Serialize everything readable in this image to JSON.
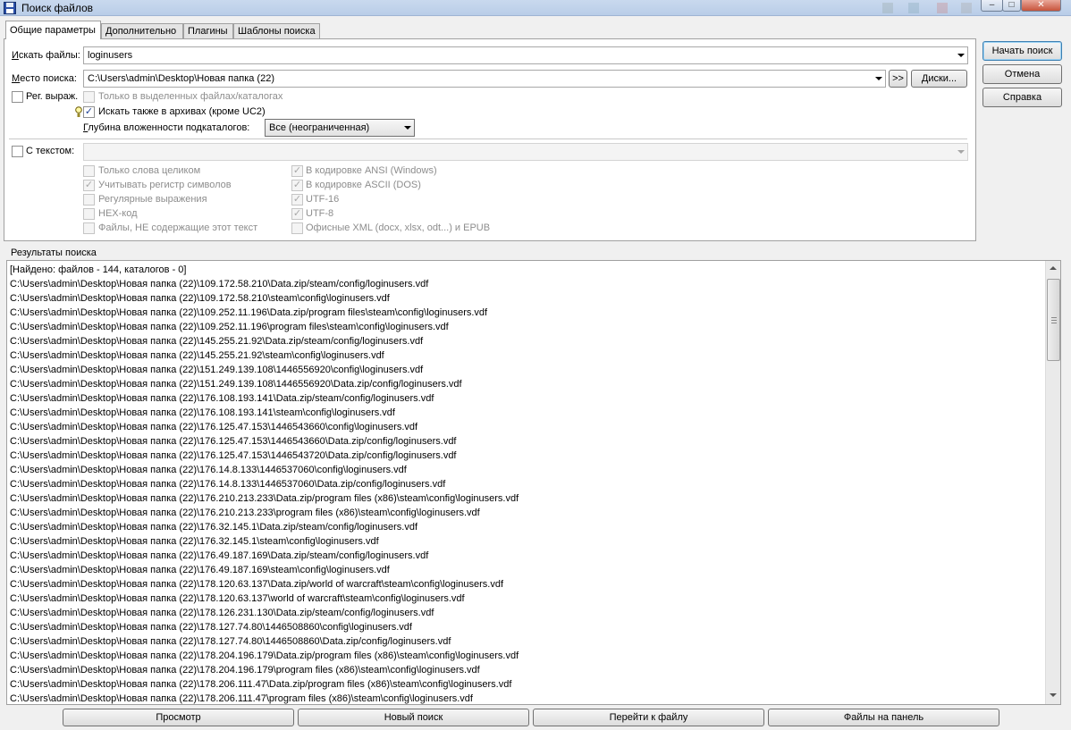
{
  "window": {
    "title": "Поиск файлов",
    "minimize": "–",
    "maximize": "□",
    "close": "✕"
  },
  "tabs": [
    {
      "label": "Общие параметры",
      "active": true
    },
    {
      "label": "Дополнительно",
      "active": false
    },
    {
      "label": "Плагины",
      "active": false
    },
    {
      "label": "Шаблоны поиска",
      "active": false
    }
  ],
  "general": {
    "search_files_label_u": "И",
    "search_files_label_rest": "скать файлы:",
    "search_files_value": "loginusers",
    "location_label_u": "М",
    "location_label_rest": "есто поиска:",
    "location_value": "C:\\Users\\admin\\Desktop\\Новая папка (22)",
    "browse_label": ">>",
    "drives_label": "Диски...",
    "regex_label": "Рег. выраж.",
    "only_selected_label": "Только в выделенных файлах/каталогах",
    "search_archives_label": "Искать также в архивах (кроме UC2)",
    "depth_label_u": "Г",
    "depth_label_rest": "лубина вложенности подкаталогов:",
    "depth_value": "Все (неограниченная)",
    "with_text_label": "С текстом:",
    "with_text_value": ""
  },
  "text_options": {
    "whole_words": "Только слова целиком",
    "case_sensitive": "Учитывать регистр символов",
    "regex": "Регулярные выражения",
    "hex": "HEX-код",
    "not_containing": "Файлы, НЕ содержащие этот текст",
    "ansi": "В кодировке ANSI (Windows)",
    "ascii": "В кодировке ASCII (DOS)",
    "utf16": "UTF-16",
    "utf8": "UTF-8",
    "office_xml": "Офисные XML (docx, xlsx, odt...) и EPUB"
  },
  "side_buttons": {
    "start": "Начать поиск",
    "cancel": "Отмена",
    "help": "Справка"
  },
  "results": {
    "label": "Результаты поиска",
    "items": [
      "[Найдено: файлов - 144, каталогов - 0]",
      "C:\\Users\\admin\\Desktop\\Новая папка (22)\\109.172.58.210\\Data.zip/steam/config/loginusers.vdf",
      "C:\\Users\\admin\\Desktop\\Новая папка (22)\\109.172.58.210\\steam\\config\\loginusers.vdf",
      "C:\\Users\\admin\\Desktop\\Новая папка (22)\\109.252.11.196\\Data.zip/program files\\steam\\config\\loginusers.vdf",
      "C:\\Users\\admin\\Desktop\\Новая папка (22)\\109.252.11.196\\program files\\steam\\config\\loginusers.vdf",
      "C:\\Users\\admin\\Desktop\\Новая папка (22)\\145.255.21.92\\Data.zip/steam/config/loginusers.vdf",
      "C:\\Users\\admin\\Desktop\\Новая папка (22)\\145.255.21.92\\steam\\config\\loginusers.vdf",
      "C:\\Users\\admin\\Desktop\\Новая папка (22)\\151.249.139.108\\1446556920\\config\\loginusers.vdf",
      "C:\\Users\\admin\\Desktop\\Новая папка (22)\\151.249.139.108\\1446556920\\Data.zip/config/loginusers.vdf",
      "C:\\Users\\admin\\Desktop\\Новая папка (22)\\176.108.193.141\\Data.zip/steam/config/loginusers.vdf",
      "C:\\Users\\admin\\Desktop\\Новая папка (22)\\176.108.193.141\\steam\\config\\loginusers.vdf",
      "C:\\Users\\admin\\Desktop\\Новая папка (22)\\176.125.47.153\\1446543660\\config\\loginusers.vdf",
      "C:\\Users\\admin\\Desktop\\Новая папка (22)\\176.125.47.153\\1446543660\\Data.zip/config/loginusers.vdf",
      "C:\\Users\\admin\\Desktop\\Новая папка (22)\\176.125.47.153\\1446543720\\Data.zip/config/loginusers.vdf",
      "C:\\Users\\admin\\Desktop\\Новая папка (22)\\176.14.8.133\\1446537060\\config\\loginusers.vdf",
      "C:\\Users\\admin\\Desktop\\Новая папка (22)\\176.14.8.133\\1446537060\\Data.zip/config/loginusers.vdf",
      "C:\\Users\\admin\\Desktop\\Новая папка (22)\\176.210.213.233\\Data.zip/program files (x86)\\steam\\config\\loginusers.vdf",
      "C:\\Users\\admin\\Desktop\\Новая папка (22)\\176.210.213.233\\program files (x86)\\steam\\config\\loginusers.vdf",
      "C:\\Users\\admin\\Desktop\\Новая папка (22)\\176.32.145.1\\Data.zip/steam/config/loginusers.vdf",
      "C:\\Users\\admin\\Desktop\\Новая папка (22)\\176.32.145.1\\steam\\config\\loginusers.vdf",
      "C:\\Users\\admin\\Desktop\\Новая папка (22)\\176.49.187.169\\Data.zip/steam/config/loginusers.vdf",
      "C:\\Users\\admin\\Desktop\\Новая папка (22)\\176.49.187.169\\steam\\config\\loginusers.vdf",
      "C:\\Users\\admin\\Desktop\\Новая папка (22)\\178.120.63.137\\Data.zip/world of warcraft\\steam\\config\\loginusers.vdf",
      "C:\\Users\\admin\\Desktop\\Новая папка (22)\\178.120.63.137\\world of warcraft\\steam\\config\\loginusers.vdf",
      "C:\\Users\\admin\\Desktop\\Новая папка (22)\\178.126.231.130\\Data.zip/steam/config/loginusers.vdf",
      "C:\\Users\\admin\\Desktop\\Новая папка (22)\\178.127.74.80\\1446508860\\config\\loginusers.vdf",
      "C:\\Users\\admin\\Desktop\\Новая папка (22)\\178.127.74.80\\1446508860\\Data.zip/config/loginusers.vdf",
      "C:\\Users\\admin\\Desktop\\Новая папка (22)\\178.204.196.179\\Data.zip/program files (x86)\\steam\\config\\loginusers.vdf",
      "C:\\Users\\admin\\Desktop\\Новая папка (22)\\178.204.196.179\\program files (x86)\\steam\\config\\loginusers.vdf",
      "C:\\Users\\admin\\Desktop\\Новая папка (22)\\178.206.111.47\\Data.zip/program files (x86)\\steam\\config\\loginusers.vdf",
      "C:\\Users\\admin\\Desktop\\Новая папка (22)\\178.206.111.47\\program files (x86)\\steam\\config\\loginusers.vdf"
    ]
  },
  "bottom_buttons": {
    "view": "Просмотр",
    "new_search": "Новый поиск",
    "goto_file": "Перейти к файлу",
    "to_panel": "Файлы на панель"
  },
  "colors": {
    "titlebar": "#b9cde8",
    "default_button_border": "#3c7fb1",
    "checkmark": "#1c3f94"
  }
}
